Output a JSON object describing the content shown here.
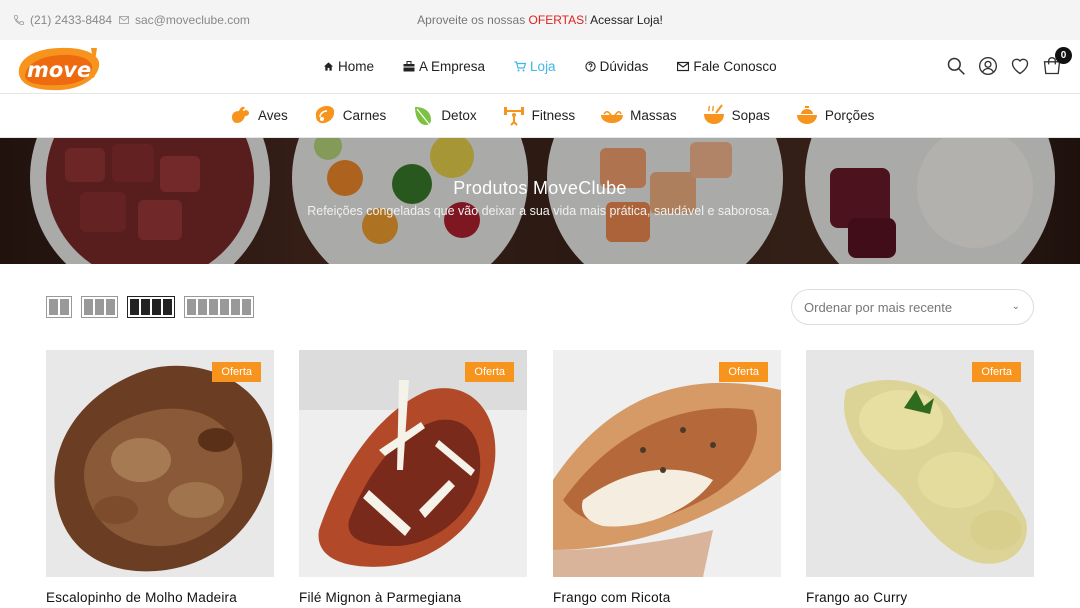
{
  "topbar": {
    "phone": "(21) 2433-8484",
    "email": "sac@moveclube.com",
    "promo_prefix": "Aproveite os nossas ",
    "promo_highlight": "OFERTAS",
    "promo_suffix": "! ",
    "promo_cta": "Acessar Loja!"
  },
  "header": {
    "logo_text": "move",
    "nav": [
      {
        "label": "Home",
        "icon": "home-icon"
      },
      {
        "label": "A Empresa",
        "icon": "briefcase-icon"
      },
      {
        "label": "Loja",
        "icon": "cart-icon"
      },
      {
        "label": "Dúvidas",
        "icon": "question-icon"
      },
      {
        "label": "Fale Conosco",
        "icon": "envelope-icon"
      }
    ],
    "cart_count": "0"
  },
  "categories": [
    {
      "label": "Aves",
      "icon": "chicken-icon"
    },
    {
      "label": "Carnes",
      "icon": "steak-icon"
    },
    {
      "label": "Detox",
      "icon": "leaf-icon"
    },
    {
      "label": "Fitness",
      "icon": "dumbbell-icon"
    },
    {
      "label": "Massas",
      "icon": "pasta-icon"
    },
    {
      "label": "Sopas",
      "icon": "soup-icon"
    },
    {
      "label": "Porções",
      "icon": "bowl-icon"
    }
  ],
  "hero": {
    "title": "Produtos MoveClube",
    "subtitle": "Refeições congeladas que vão deixar a sua vida mais prática, saudável e saborosa."
  },
  "toolbar": {
    "sort_value": "Ordenar por mais recente"
  },
  "products": [
    {
      "name": "Escalopinho de Molho Madeira",
      "badge": "Oferta"
    },
    {
      "name": "Filé Mignon à Parmegiana",
      "badge": "Oferta"
    },
    {
      "name": "Frango com Ricota",
      "badge": "Oferta"
    },
    {
      "name": "Frango ao Curry",
      "badge": "Oferta"
    }
  ],
  "colors": {
    "accent": "#3fb6e8",
    "brand_orange": "#f7941d",
    "promo_red": "#e02020"
  }
}
